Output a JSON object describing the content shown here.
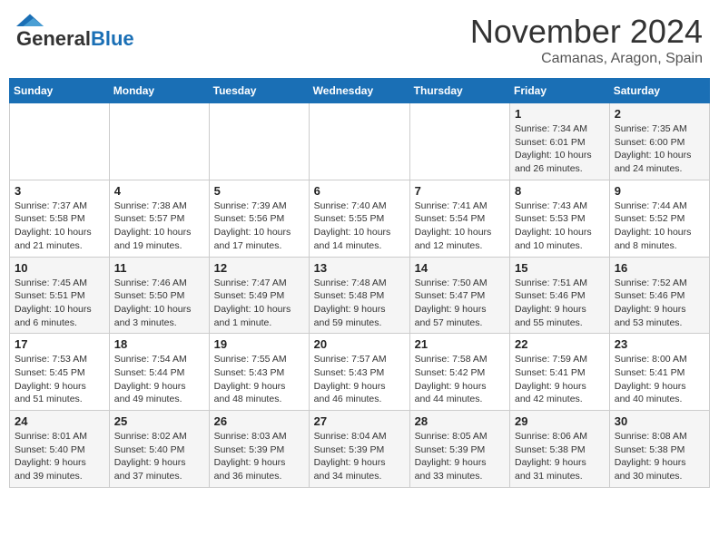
{
  "header": {
    "logo_general": "General",
    "logo_blue": "Blue",
    "month_title": "November 2024",
    "location": "Camanas, Aragon, Spain"
  },
  "weekdays": [
    "Sunday",
    "Monday",
    "Tuesday",
    "Wednesday",
    "Thursday",
    "Friday",
    "Saturday"
  ],
  "weeks": [
    [
      {
        "day": "",
        "info": ""
      },
      {
        "day": "",
        "info": ""
      },
      {
        "day": "",
        "info": ""
      },
      {
        "day": "",
        "info": ""
      },
      {
        "day": "",
        "info": ""
      },
      {
        "day": "1",
        "info": "Sunrise: 7:34 AM\nSunset: 6:01 PM\nDaylight: 10 hours\nand 26 minutes."
      },
      {
        "day": "2",
        "info": "Sunrise: 7:35 AM\nSunset: 6:00 PM\nDaylight: 10 hours\nand 24 minutes."
      }
    ],
    [
      {
        "day": "3",
        "info": "Sunrise: 7:37 AM\nSunset: 5:58 PM\nDaylight: 10 hours\nand 21 minutes."
      },
      {
        "day": "4",
        "info": "Sunrise: 7:38 AM\nSunset: 5:57 PM\nDaylight: 10 hours\nand 19 minutes."
      },
      {
        "day": "5",
        "info": "Sunrise: 7:39 AM\nSunset: 5:56 PM\nDaylight: 10 hours\nand 17 minutes."
      },
      {
        "day": "6",
        "info": "Sunrise: 7:40 AM\nSunset: 5:55 PM\nDaylight: 10 hours\nand 14 minutes."
      },
      {
        "day": "7",
        "info": "Sunrise: 7:41 AM\nSunset: 5:54 PM\nDaylight: 10 hours\nand 12 minutes."
      },
      {
        "day": "8",
        "info": "Sunrise: 7:43 AM\nSunset: 5:53 PM\nDaylight: 10 hours\nand 10 minutes."
      },
      {
        "day": "9",
        "info": "Sunrise: 7:44 AM\nSunset: 5:52 PM\nDaylight: 10 hours\nand 8 minutes."
      }
    ],
    [
      {
        "day": "10",
        "info": "Sunrise: 7:45 AM\nSunset: 5:51 PM\nDaylight: 10 hours\nand 6 minutes."
      },
      {
        "day": "11",
        "info": "Sunrise: 7:46 AM\nSunset: 5:50 PM\nDaylight: 10 hours\nand 3 minutes."
      },
      {
        "day": "12",
        "info": "Sunrise: 7:47 AM\nSunset: 5:49 PM\nDaylight: 10 hours\nand 1 minute."
      },
      {
        "day": "13",
        "info": "Sunrise: 7:48 AM\nSunset: 5:48 PM\nDaylight: 9 hours\nand 59 minutes."
      },
      {
        "day": "14",
        "info": "Sunrise: 7:50 AM\nSunset: 5:47 PM\nDaylight: 9 hours\nand 57 minutes."
      },
      {
        "day": "15",
        "info": "Sunrise: 7:51 AM\nSunset: 5:46 PM\nDaylight: 9 hours\nand 55 minutes."
      },
      {
        "day": "16",
        "info": "Sunrise: 7:52 AM\nSunset: 5:46 PM\nDaylight: 9 hours\nand 53 minutes."
      }
    ],
    [
      {
        "day": "17",
        "info": "Sunrise: 7:53 AM\nSunset: 5:45 PM\nDaylight: 9 hours\nand 51 minutes."
      },
      {
        "day": "18",
        "info": "Sunrise: 7:54 AM\nSunset: 5:44 PM\nDaylight: 9 hours\nand 49 minutes."
      },
      {
        "day": "19",
        "info": "Sunrise: 7:55 AM\nSunset: 5:43 PM\nDaylight: 9 hours\nand 48 minutes."
      },
      {
        "day": "20",
        "info": "Sunrise: 7:57 AM\nSunset: 5:43 PM\nDaylight: 9 hours\nand 46 minutes."
      },
      {
        "day": "21",
        "info": "Sunrise: 7:58 AM\nSunset: 5:42 PM\nDaylight: 9 hours\nand 44 minutes."
      },
      {
        "day": "22",
        "info": "Sunrise: 7:59 AM\nSunset: 5:41 PM\nDaylight: 9 hours\nand 42 minutes."
      },
      {
        "day": "23",
        "info": "Sunrise: 8:00 AM\nSunset: 5:41 PM\nDaylight: 9 hours\nand 40 minutes."
      }
    ],
    [
      {
        "day": "24",
        "info": "Sunrise: 8:01 AM\nSunset: 5:40 PM\nDaylight: 9 hours\nand 39 minutes."
      },
      {
        "day": "25",
        "info": "Sunrise: 8:02 AM\nSunset: 5:40 PM\nDaylight: 9 hours\nand 37 minutes."
      },
      {
        "day": "26",
        "info": "Sunrise: 8:03 AM\nSunset: 5:39 PM\nDaylight: 9 hours\nand 36 minutes."
      },
      {
        "day": "27",
        "info": "Sunrise: 8:04 AM\nSunset: 5:39 PM\nDaylight: 9 hours\nand 34 minutes."
      },
      {
        "day": "28",
        "info": "Sunrise: 8:05 AM\nSunset: 5:39 PM\nDaylight: 9 hours\nand 33 minutes."
      },
      {
        "day": "29",
        "info": "Sunrise: 8:06 AM\nSunset: 5:38 PM\nDaylight: 9 hours\nand 31 minutes."
      },
      {
        "day": "30",
        "info": "Sunrise: 8:08 AM\nSunset: 5:38 PM\nDaylight: 9 hours\nand 30 minutes."
      }
    ]
  ]
}
